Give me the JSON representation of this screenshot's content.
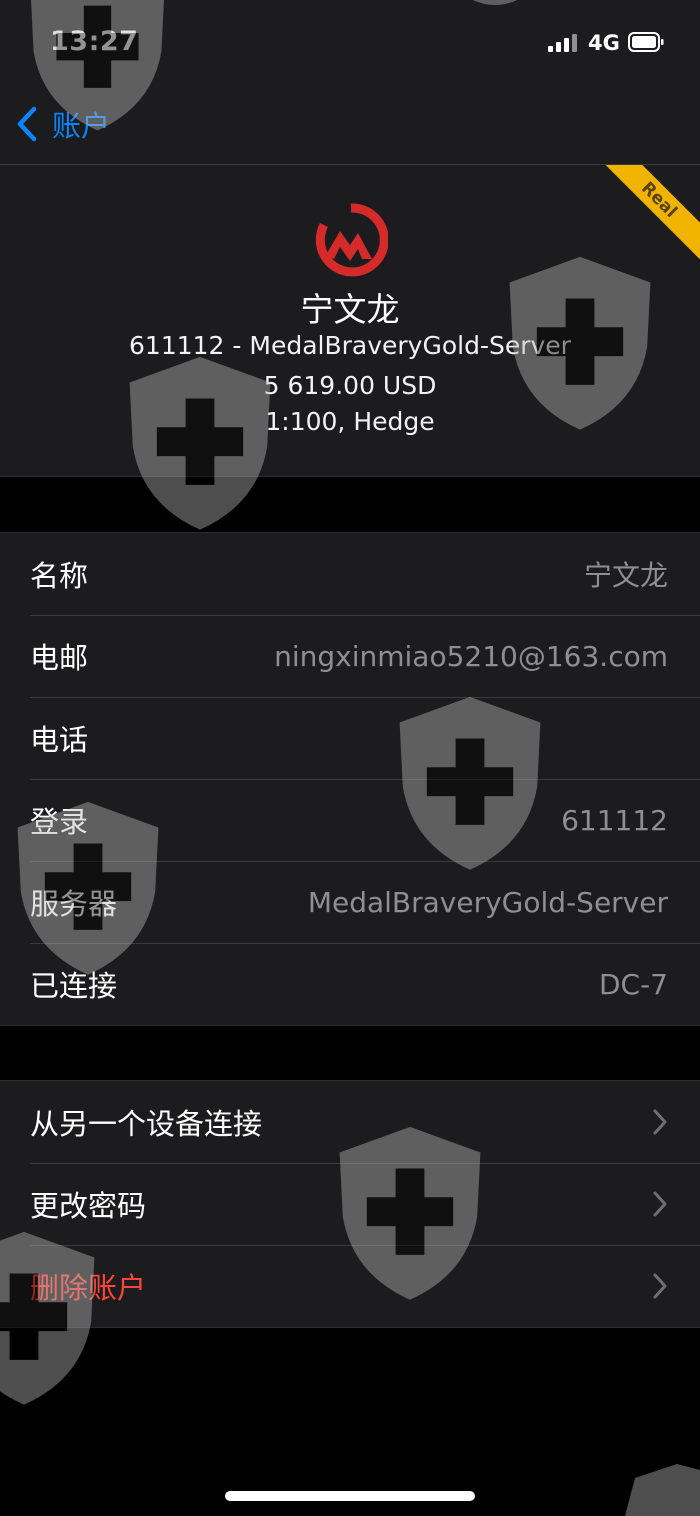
{
  "status": {
    "time": "13:27",
    "network": "4G"
  },
  "nav": {
    "back_label": "账户"
  },
  "account": {
    "name": "宁文龙",
    "server_line": "611112 - MedalBraveryGold-Server",
    "balance": "5 619.00 USD",
    "leverage": "1:100, Hedge",
    "badge": "Real"
  },
  "details": [
    {
      "label": "名称",
      "value": "宁文龙"
    },
    {
      "label": "电邮",
      "value": "ningxinmiao5210@163.com"
    },
    {
      "label": "电话",
      "value": ""
    },
    {
      "label": "登录",
      "value": "611112"
    },
    {
      "label": "服务器",
      "value": "MedalBraveryGold-Server"
    },
    {
      "label": "已连接",
      "value": "DC-7"
    }
  ],
  "actions": [
    {
      "label": "从另一个设备连接"
    },
    {
      "label": "更改密码"
    },
    {
      "label": "删除账户"
    }
  ],
  "colors": {
    "accent": "#0a84ff",
    "danger": "#ff453a",
    "badge": "#f0b400",
    "logo": "#d42a2a"
  },
  "icons": {
    "back": "chevron-left-icon",
    "row": "chevron-right-icon",
    "watermark": "shield-cross-icon"
  }
}
